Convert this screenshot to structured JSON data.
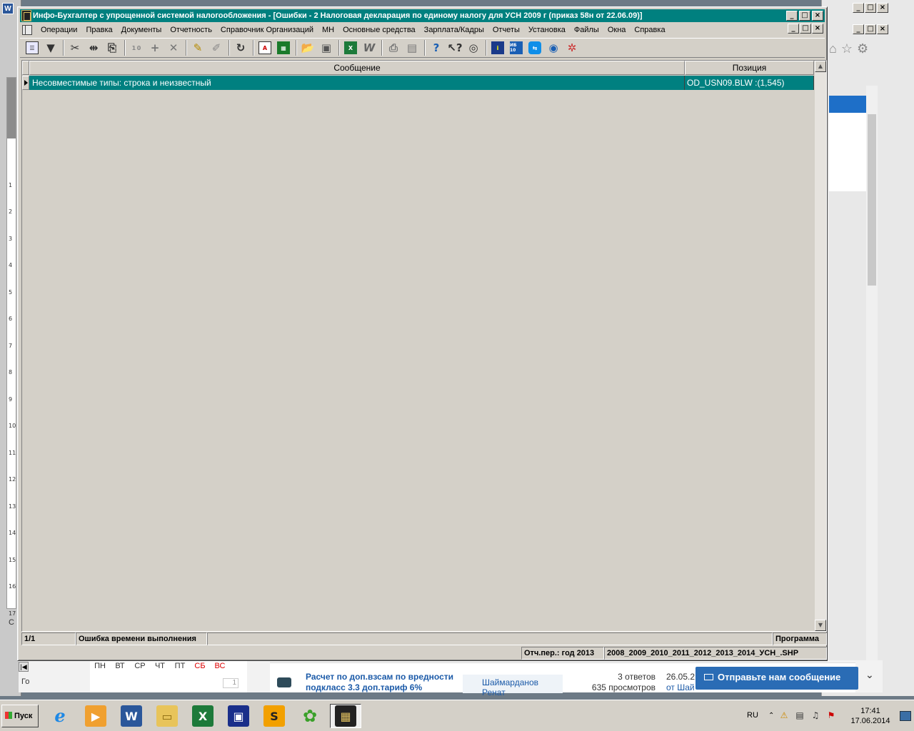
{
  "window": {
    "title": "Инфо-Бухгалтер с упрощенной системой налогообложения - [Ошибки -     2  Налоговая декларация по единому налогу для УСН 2009 г (приказ 58н от 22.06.09)]",
    "min_label": "_",
    "max_label": "□",
    "close_label": "×"
  },
  "menu": {
    "items": [
      "Операции",
      "Правка",
      "Документы",
      "Отчетность",
      "Справочник Организаций",
      "МН",
      "Основные средства",
      "Зарплата/Кадры",
      "Отчеты",
      "Установка",
      "Файлы",
      "Окна",
      "Справка"
    ]
  },
  "toolbar": {
    "icons": [
      "list-view-icon",
      "filter-icon",
      "cut-icon",
      "move-icon",
      "copy-icon",
      "counter-icon",
      "add-icon",
      "delete-icon",
      "mark-icon",
      "unmark-icon",
      "refresh-icon",
      "report-icon",
      "calculator-icon",
      "open-folder-icon",
      "save-icon",
      "excel-icon",
      "word-icon",
      "print-icon",
      "preview-icon",
      "help-icon",
      "context-help-icon",
      "compass-icon",
      "info-icon",
      "ib10-icon",
      "teamviewer-icon",
      "internet-icon",
      "network-icon"
    ],
    "counter_label": "1 0",
    "ib10_label": "ИБ 10"
  },
  "grid": {
    "columns": [
      "Сообщение",
      "Позиция"
    ],
    "rows": [
      {
        "message": "Несовместимые типы: строка и неизвестный",
        "position": "OD_USN09.BLW :(1,545)"
      }
    ]
  },
  "status": {
    "record": "1/1",
    "error_type": "Ошибка времени выполнения",
    "source": "Программа",
    "period": "Отч.пер.: год 2013",
    "years": "2008_2009_2010_2011_2012_2013_2014_УСН_.SHP"
  },
  "background": {
    "calendar_days": [
      "ПН",
      "ВТ",
      "СР",
      "ЧТ",
      "ПТ",
      "СБ",
      "ВС"
    ],
    "calendar_value": "1",
    "goto_label": "Го",
    "word_side_label": "С",
    "forum_title": "Расчет по доп.взсам по вредности подкласс 3.3 доп.тариф 6%",
    "forum_author": "Шаймарданов Ренат",
    "forum_replies": "3 ответов",
    "forum_views": "635 просмотров",
    "forum_date": "26.05.2",
    "forum_from": "от Шай",
    "send_message": "Отправьте нам сообщение"
  },
  "taskbar": {
    "start_label": "Пуск",
    "apps": [
      "internet-explorer-icon",
      "media-player-icon",
      "word-icon",
      "explorer-folder-icon",
      "excel-icon",
      "floppy-save-icon",
      "s-app-icon",
      "icq-icon",
      "info-accountant-icon"
    ],
    "lang": "RU",
    "time": "17:41",
    "date": "17.06.2014"
  },
  "colors": {
    "titlebar": "#00807f",
    "selection": "#008080",
    "face": "#d4d0c8"
  }
}
